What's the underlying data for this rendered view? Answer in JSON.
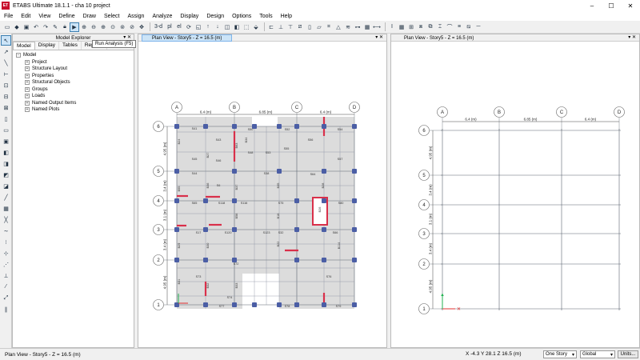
{
  "window": {
    "title": "ETABS Ultimate 18.1.1 - cha 10 project",
    "logo": "ET",
    "minimize": "–",
    "maximize": "☐",
    "close": "✕"
  },
  "menu": [
    "File",
    "Edit",
    "View",
    "Define",
    "Draw",
    "Select",
    "Assign",
    "Analyze",
    "Display",
    "Design",
    "Options",
    "Tools",
    "Help"
  ],
  "toolbar": {
    "run_tooltip": "Run Analysis (F5)",
    "label_3d": "3-d",
    "label_pl": "pl",
    "label_el": "el"
  },
  "explorer": {
    "title": "Model Explorer",
    "controls": "▾ ✕",
    "tabs": [
      "Model",
      "Display",
      "Tables",
      "Reports"
    ],
    "root": "Model",
    "items": [
      "Project",
      "Structure Layout",
      "Properties",
      "Structural Objects",
      "Groups",
      "Loads",
      "Named Output Items",
      "Named Plots"
    ]
  },
  "view1": {
    "title": "Plan View - Story5 - Z = 16.5 (m)",
    "controls": "▾ ✕"
  },
  "view2": {
    "title": "Plan View - Story5 - Z = 16.5 (m)",
    "controls": "▾ ✕"
  },
  "grid": {
    "x_labels": [
      "A",
      "B",
      "C",
      "D"
    ],
    "y_labels": [
      "6",
      "5",
      "4",
      "3",
      "2",
      "1"
    ],
    "x_dims": [
      "6.4 (m)",
      "6.85 (m)",
      "6.4 (m)"
    ],
    "y_dims": [
      "4.95 (m)",
      "3.4 (m)",
      "3.1 (m)",
      "3.4 (m)",
      "4.95 (m)"
    ]
  },
  "slabs": [
    "S41",
    "S43",
    "S50",
    "S52",
    "S54",
    "S45",
    "S46",
    "S48",
    "S53",
    "S55",
    "S56",
    "S57",
    "S44",
    "S6",
    "S38",
    "S64",
    "S65",
    "S118",
    "S116",
    "S75",
    "S80",
    "S17",
    "S120",
    "S123",
    "S32",
    "S66",
    "S72",
    "S73",
    "S74",
    "S76",
    "S77",
    "S78",
    "S79"
  ],
  "beams": [
    "B24",
    "B27",
    "B63",
    "B34",
    "B55",
    "B36",
    "B37",
    "B58",
    "B35",
    "B18",
    "B22",
    "B26",
    "B114",
    "B28",
    "B29",
    "B30",
    "B31",
    "B32",
    "B33"
  ],
  "status": {
    "left": "Plan View - Story5 - Z = 16.5 (m)",
    "coords": "X -4.3  Y 28.1  Z 16.5 (m)",
    "story": "One Story",
    "coord_sys": "Global",
    "units": "Units..."
  },
  "colors": {
    "slab": "#dcdcdc",
    "grid": "#5b6470",
    "column": "#4b5ea5",
    "wall": "#d9304a",
    "axis_x": "#e03030",
    "axis_y": "#22b050"
  }
}
